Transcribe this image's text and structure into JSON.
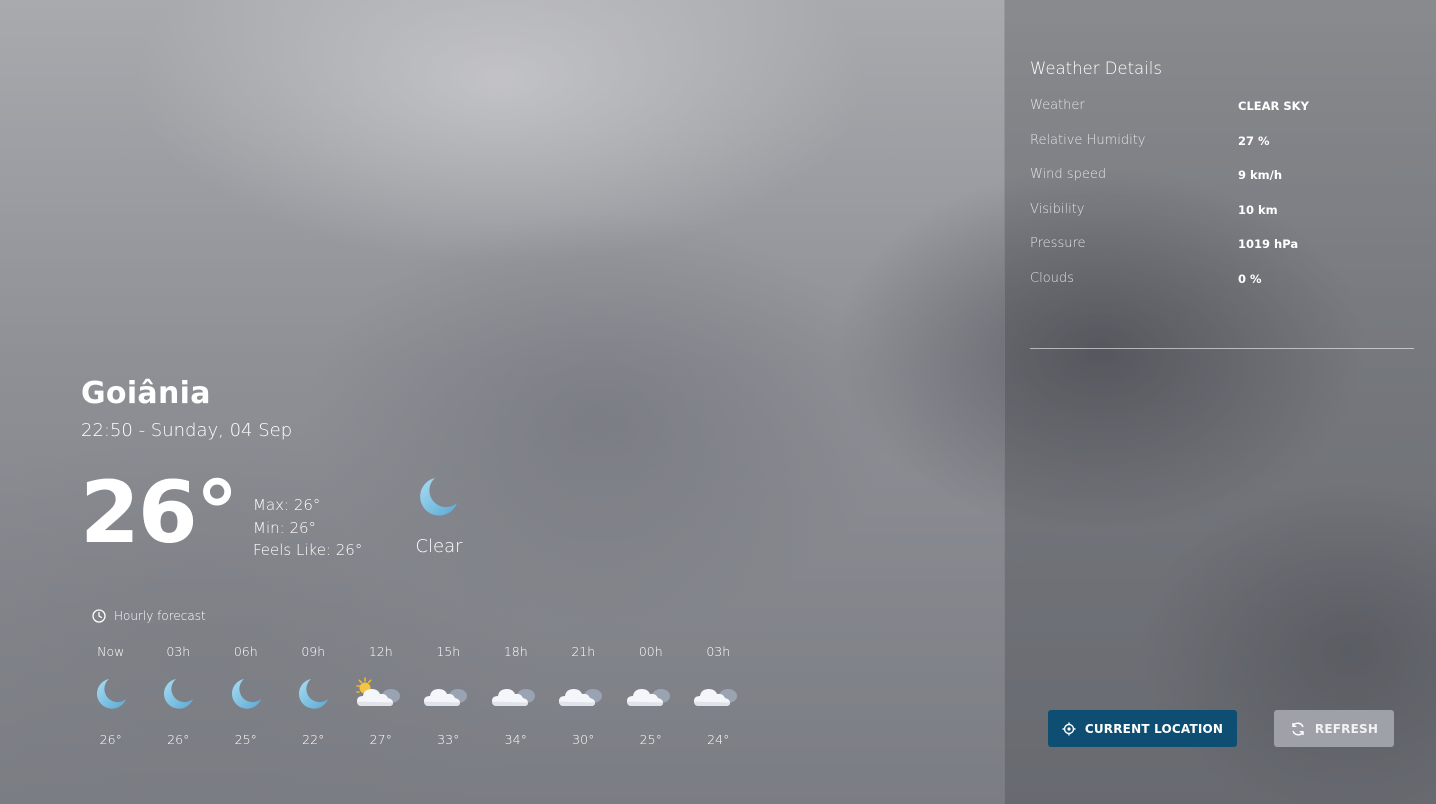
{
  "location": {
    "city": "Goiânia",
    "datetime": "22:50 - Sunday, 04 Sep"
  },
  "current": {
    "temperature": "26°",
    "max": "Max: 26°",
    "min": "Min: 26°",
    "feels_like": "Feels Like: 26°",
    "condition": "Clear",
    "condition_icon": "moon-icon"
  },
  "hourly": {
    "title": "Hourly forecast",
    "title_icon": "clock-icon",
    "items": [
      {
        "time": "Now",
        "icon": "moon-icon",
        "temp": "26°"
      },
      {
        "time": "03h",
        "icon": "moon-icon",
        "temp": "26°"
      },
      {
        "time": "06h",
        "icon": "moon-icon",
        "temp": "25°"
      },
      {
        "time": "09h",
        "icon": "moon-icon",
        "temp": "22°"
      },
      {
        "time": "12h",
        "icon": "sun-cloud-icon",
        "temp": "27°"
      },
      {
        "time": "15h",
        "icon": "cloud-icon",
        "temp": "33°"
      },
      {
        "time": "18h",
        "icon": "cloud-icon",
        "temp": "34°"
      },
      {
        "time": "21h",
        "icon": "cloud-icon",
        "temp": "30°"
      },
      {
        "time": "00h",
        "icon": "cloud-icon",
        "temp": "25°"
      },
      {
        "time": "03h",
        "icon": "cloud-icon",
        "temp": "24°"
      }
    ]
  },
  "details": {
    "title": "Weather Details",
    "rows": [
      {
        "label": "Weather",
        "value": "CLEAR SKY"
      },
      {
        "label": "Relative Humidity",
        "value": "27 %"
      },
      {
        "label": "Wind speed",
        "value": "9 km/h"
      },
      {
        "label": "Visibility",
        "value": "10 km"
      },
      {
        "label": "Pressure",
        "value": "1019 hPa"
      },
      {
        "label": "Clouds",
        "value": "0 %"
      }
    ]
  },
  "actions": {
    "current_location": "CURRENT LOCATION",
    "current_location_icon": "crosshair-icon",
    "refresh": "REFRESH",
    "refresh_icon": "refresh-icon"
  },
  "colors": {
    "primary_button": "#0f4e73",
    "secondary_button": "#9fa1a8",
    "moon": "#7ec3e3"
  }
}
